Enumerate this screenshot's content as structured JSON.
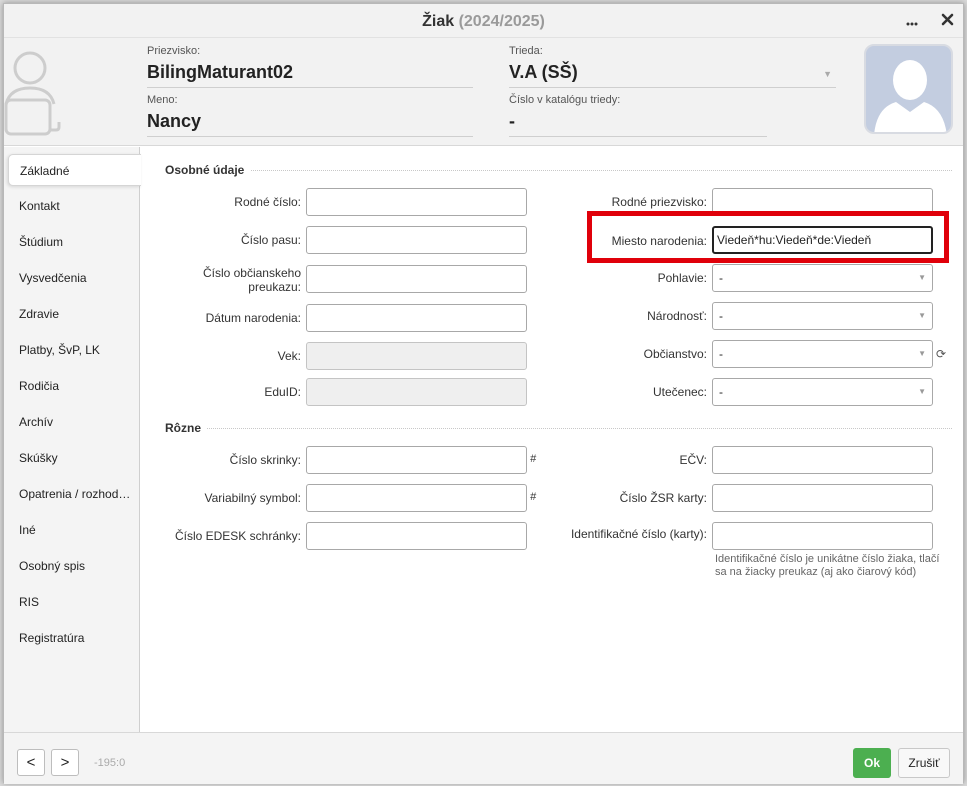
{
  "titlebar": {
    "title": "Žiak",
    "year": "(2024/2025)",
    "menu_icon": "ellipsis-icon",
    "close_icon": "close-icon"
  },
  "header": {
    "surname_label": "Priezvisko:",
    "surname_value": "BilingMaturant02",
    "name_label": "Meno:",
    "name_value": "Nancy",
    "class_label": "Trieda:",
    "class_value": "V.A (SŠ)",
    "catalog_label": "Číslo v katalógu triedy:",
    "catalog_value": "-"
  },
  "sidebar": {
    "items": [
      {
        "label": "Základné"
      },
      {
        "label": "Kontakt"
      },
      {
        "label": "Štúdium"
      },
      {
        "label": "Vysvedčenia"
      },
      {
        "label": "Zdravie"
      },
      {
        "label": "Platby, ŠvP, LK"
      },
      {
        "label": "Rodičia"
      },
      {
        "label": "Archív"
      },
      {
        "label": "Skúšky"
      },
      {
        "label": "Opatrenia / rozhodnutia"
      },
      {
        "label": "Iné"
      },
      {
        "label": "Osobný spis"
      },
      {
        "label": "RIS"
      },
      {
        "label": "Registratúra"
      }
    ]
  },
  "section_personal": "Osobné údaje",
  "section_other": "Rôzne",
  "left_fields": [
    {
      "label": "Rodné číslo:",
      "value": ""
    },
    {
      "label": "Číslo pasu:",
      "value": ""
    },
    {
      "label1": "Číslo občianskeho",
      "label2": "preukazu:",
      "value": ""
    },
    {
      "label": "Dátum narodenia:",
      "value": ""
    },
    {
      "label": "Vek:",
      "value": ""
    },
    {
      "label": "EduID:",
      "value": ""
    }
  ],
  "right_fields": [
    {
      "label": "Rodné priezvisko:",
      "value": ""
    },
    {
      "label": "Miesto narodenia:",
      "value": "Viedeň*hu:Viedeň*de:Viedeň"
    },
    {
      "label": "Pohlavie:",
      "value": "-"
    },
    {
      "label": "Národnosť:",
      "value": "-"
    },
    {
      "label": "Občianstvo:",
      "value": "-"
    },
    {
      "label": "Utečenec:",
      "value": "-"
    }
  ],
  "other_left": [
    {
      "label": "Číslo skrinky:",
      "value": ""
    },
    {
      "label": "Variabilný symbol:",
      "value": ""
    },
    {
      "label": "Číslo EDESK schránky:",
      "value": ""
    }
  ],
  "other_right": [
    {
      "label": "EČV:",
      "value": ""
    },
    {
      "label": "Číslo ŽSR karty:",
      "value": ""
    },
    {
      "label": "Identifikačné číslo (karty):",
      "value": ""
    }
  ],
  "id_hint": "Identifikačné číslo je unikátne číslo žiaka, tlačí sa na žiacky preukaz (aj ako čiarový kód)",
  "hash_glyph": "#",
  "footer": {
    "prev": "<",
    "next": ">",
    "position": "-195:0",
    "ok": "Ok",
    "cancel": "Zrušiť"
  }
}
